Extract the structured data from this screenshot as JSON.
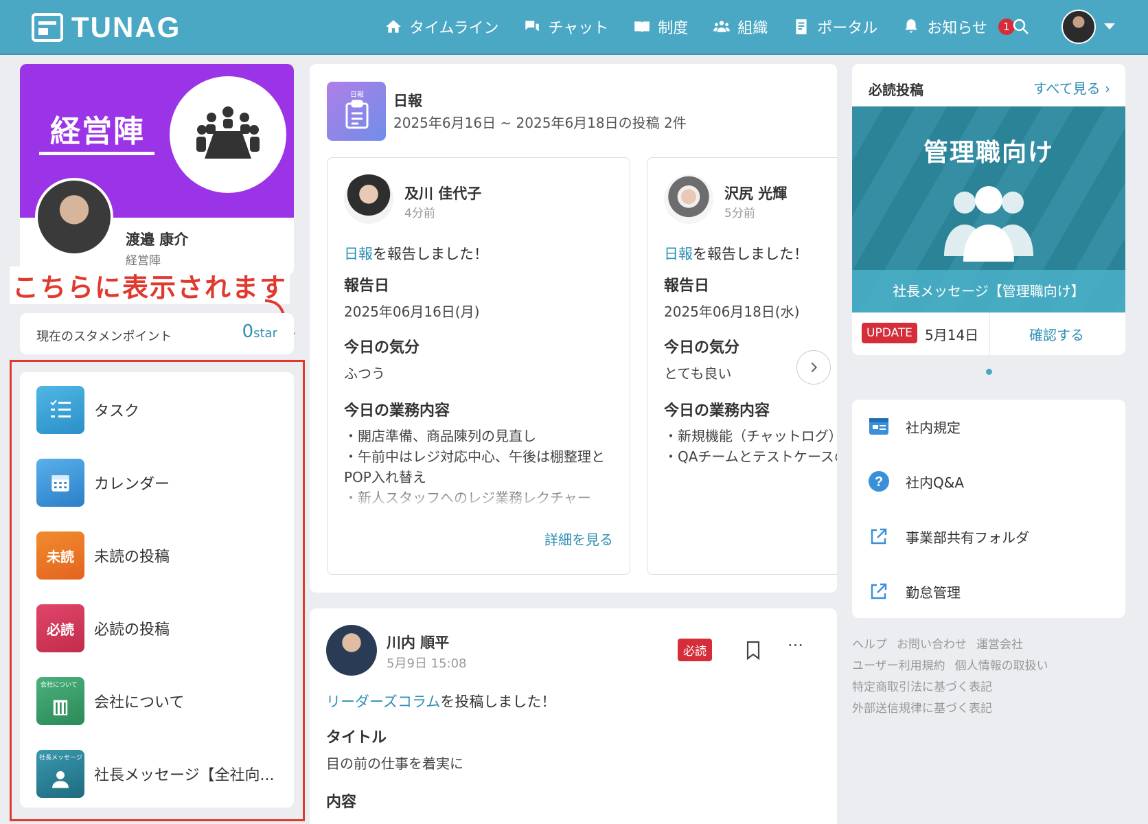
{
  "header": {
    "logo": "TUNAG",
    "nav": [
      {
        "label": "タイムライン",
        "icon": "home-icon"
      },
      {
        "label": "チャット",
        "icon": "chat-icon"
      },
      {
        "label": "制度",
        "icon": "book-icon"
      },
      {
        "label": "組織",
        "icon": "people-icon"
      },
      {
        "label": "ポータル",
        "icon": "portal-icon"
      },
      {
        "label": "お知らせ",
        "icon": "bell-icon",
        "badge": "1"
      }
    ]
  },
  "profile": {
    "banner_title": "経営陣",
    "name": "渡邉 康介",
    "role": "経営陣"
  },
  "annotation": "こちらに表示されます",
  "points": {
    "label": "現在のスタメンポイント",
    "value": "0",
    "unit": "star"
  },
  "menu": [
    {
      "label": "タスク",
      "icon": "task-icon",
      "color": "#3aa3d6"
    },
    {
      "label": "カレンダー",
      "icon": "calendar-icon",
      "color": "#3b92d6"
    },
    {
      "label": "未読の投稿",
      "icon_text": "未読",
      "color": "#ea7a2a"
    },
    {
      "label": "必読の投稿",
      "icon_text": "必読",
      "color": "#d93a5c"
    },
    {
      "label": "会社について",
      "icon_text": "会社について",
      "color": "#3a9b6a"
    },
    {
      "label": "社長メッセージ【全社向...",
      "icon_text": "社長メッセージ",
      "color": "#2d7f96"
    }
  ],
  "nippo": {
    "thumb_label": "日報",
    "title": "日報",
    "subtitle": "2025年6月16日 ~ 2025年6月18日の投稿 2件",
    "reports": [
      {
        "name": "及川 佳代子",
        "time": "4分前",
        "action_link": "日報",
        "action_text": "を報告しました！",
        "h_date": "報告日",
        "date": "2025年06月16日(月)",
        "h_mood": "今日の気分",
        "mood": "ふつう",
        "h_tasks": "今日の業務内容",
        "tasks": "・開店準備、商品陳列の見直し\n・午前中はレジ対応中心、午後は棚整理とPOP入れ替え\n・新人スタッフへのレジ業務レクチャー",
        "more": "詳細を見る"
      },
      {
        "name": "沢尻 光輝",
        "time": "5分前",
        "action_link": "日報",
        "action_text": "を報告しました！",
        "h_date": "報告日",
        "date": "2025年06月18日(水)",
        "h_mood": "今日の気分",
        "mood": "とても良い",
        "h_tasks": "今日の業務内容",
        "tasks": "・新規機能（チャットログ）の仕様整理\n・QAチームとテストケースの確認合わせ",
        "more": ""
      }
    ]
  },
  "post": {
    "name": "川内 順平",
    "time": "5月9日 15:08",
    "badge": "必読",
    "action_link": "リーダーズコラム",
    "action_text": "を投稿しました！",
    "h_title": "タイトル",
    "title": "目の前の仕事を着実に",
    "h_content": "内容"
  },
  "must_read": {
    "title": "必読投稿",
    "see_all": "すべて見る",
    "banner_title": "管理職向け",
    "banner_caption": "社長メッセージ【管理職向け】",
    "update_badge": "UPDATE",
    "date": "5月14日",
    "confirm": "確認する"
  },
  "links": [
    {
      "label": "社内規定",
      "icon": "document-icon"
    },
    {
      "label": "社内Q&A",
      "icon": "question-icon"
    },
    {
      "label": "事業部共有フォルダ",
      "icon": "external-link-icon"
    },
    {
      "label": "勤怠管理",
      "icon": "external-link-icon"
    }
  ],
  "footer": [
    "ヘルプ",
    "お問い合わせ",
    "運営会社",
    "ユーザー利用規約",
    "個人情報の取扱い",
    "特定商取引法に基づく表記",
    "外部送信規律に基づく表記"
  ]
}
